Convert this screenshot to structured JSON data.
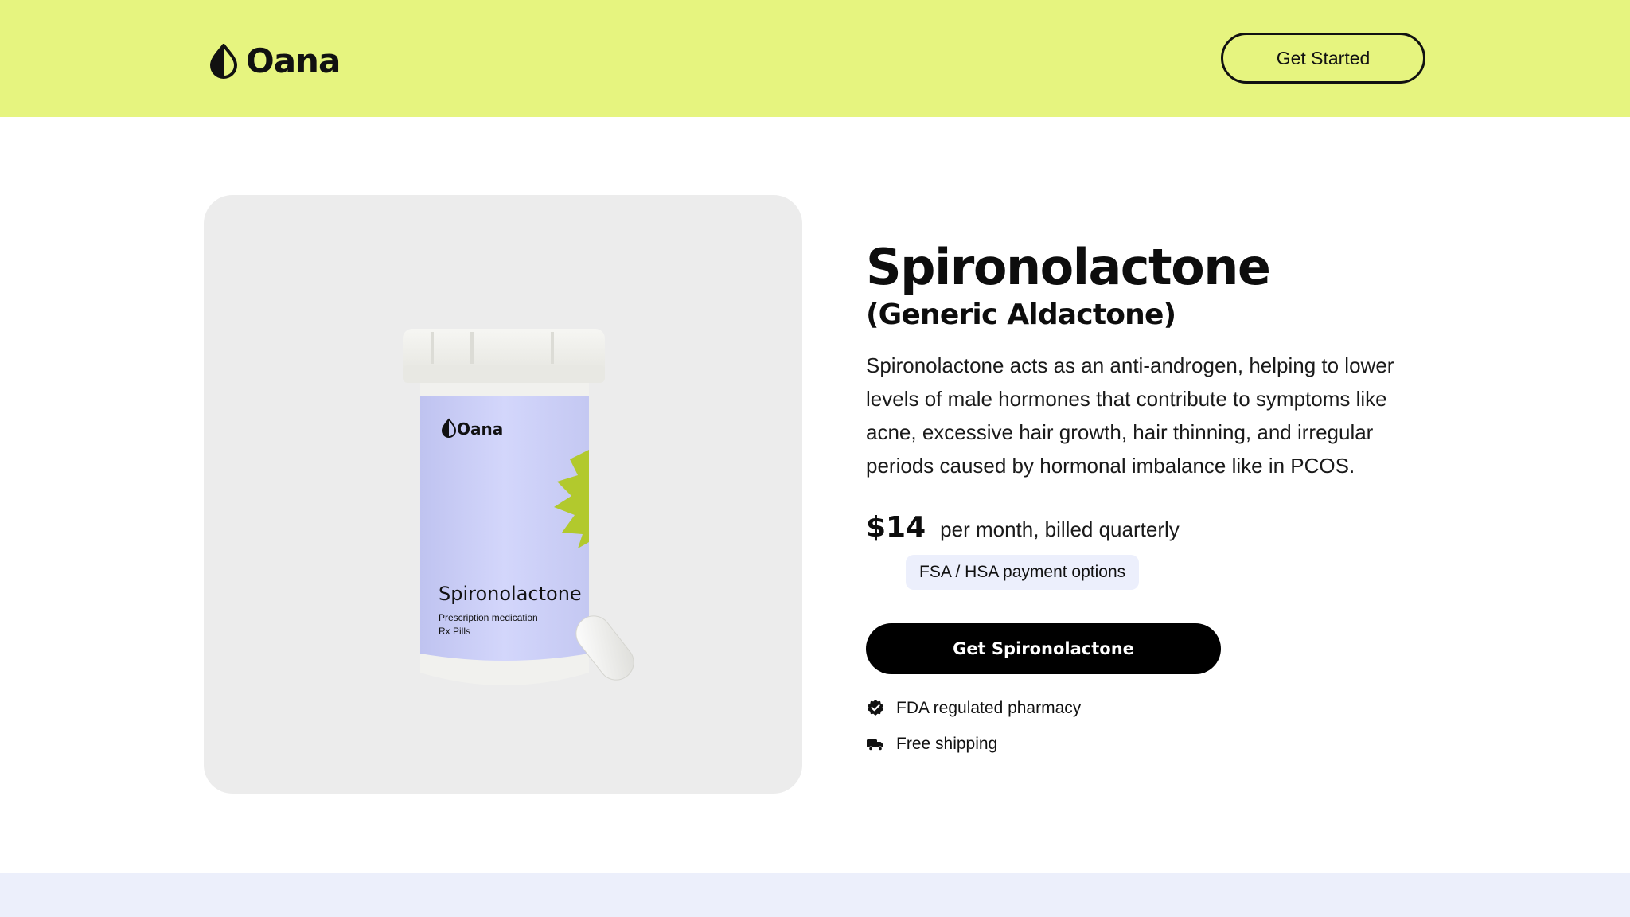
{
  "header": {
    "brand": "Oana",
    "cta_label": "Get Started",
    "background": "#e6f47f"
  },
  "product": {
    "image": {
      "brand": "Oana",
      "name": "Spironolactone",
      "line1": "Prescription medication",
      "line2": "Rx Pills"
    },
    "title": "Spironolactone",
    "subtitle": "(Generic Aldactone)",
    "description": "Spironolactone acts as an anti-androgen, helping to lower levels of male hormones that contribute to symptoms like acne, excessive hair growth, hair thinning, and irregular periods caused by hormonal imbalance like in PCOS.",
    "price": "$14",
    "price_note": "per month, billed quarterly",
    "payment_badge": "FSA / HSA payment options",
    "cta_label": "Get Spironolactone",
    "features": [
      {
        "icon": "verified-badge-icon",
        "label": "FDA regulated pharmacy"
      },
      {
        "icon": "truck-icon",
        "label": "Free shipping"
      }
    ]
  },
  "colors": {
    "accent": "#e6f47f",
    "label_purple": "#c9cdf5",
    "cta": "#000000",
    "card": "#ececec",
    "band": "#eceffb"
  }
}
